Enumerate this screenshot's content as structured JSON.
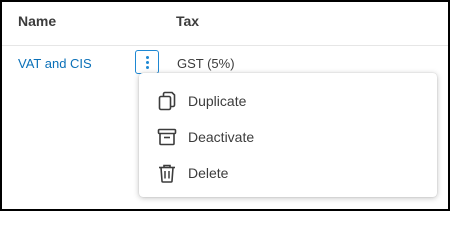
{
  "table": {
    "headers": {
      "name": "Name",
      "tax": "Tax"
    },
    "rows": [
      {
        "name": "VAT and CIS",
        "tax": "GST (5%)"
      }
    ]
  },
  "row_actions_menu": {
    "items": [
      {
        "label": "Duplicate",
        "icon": "duplicate-icon"
      },
      {
        "label": "Deactivate",
        "icon": "archive-icon"
      },
      {
        "label": "Delete",
        "icon": "trash-icon"
      }
    ]
  },
  "colors": {
    "link": "#0a70b8",
    "accent": "#1e88d3",
    "text": "#3c3c3c",
    "divider": "#e6e6e6"
  }
}
